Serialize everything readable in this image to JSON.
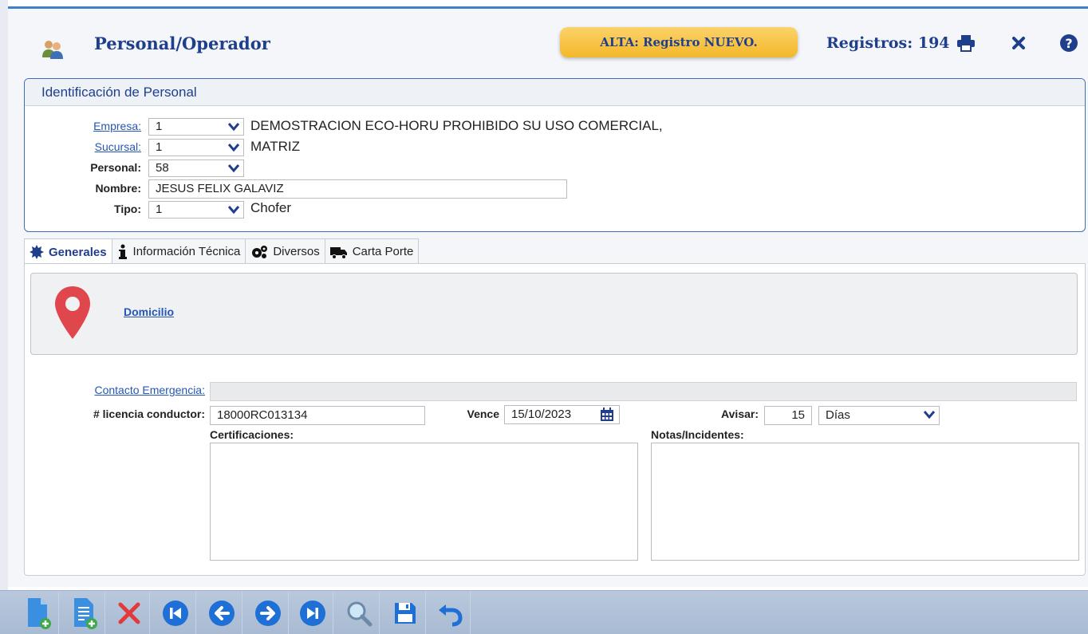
{
  "header": {
    "title": "Personal/Operador",
    "status_badge": "ALTA: Registro NUEVO.",
    "records_text": "Registros: 194"
  },
  "ident": {
    "title": "Identificación de Personal",
    "empresa": {
      "label": "Empresa:",
      "value": "1",
      "description": "DEMOSTRACION ECO-HORU PROHIBIDO SU USO COMERCIAL,"
    },
    "sucursal": {
      "label": "Sucursal:",
      "value": "1",
      "description": "MATRIZ"
    },
    "personal": {
      "label": "Personal:",
      "value": "58"
    },
    "nombre": {
      "label": "Nombre:",
      "value": "JESUS FELIX GALAVIZ"
    },
    "tipo": {
      "label": "Tipo:",
      "value": "1",
      "description": "Chofer"
    }
  },
  "tabs": [
    {
      "label": "Generales",
      "icon": "gear-badge-icon"
    },
    {
      "label": "Información Técnica",
      "icon": "info-icon"
    },
    {
      "label": "Diversos",
      "icon": "cogs-icon"
    },
    {
      "label": "Carta Porte",
      "icon": "truck-icon"
    }
  ],
  "generales": {
    "domicilio_link": "Domicilio",
    "contacto_label": "Contacto Emergencia:",
    "contacto_value": "",
    "licencia_label": "# licencia conductor:",
    "licencia_value": "18000RC013134",
    "vence_label": "Vence",
    "vence_value": "15/10/2023",
    "avisar_label": "Avisar:",
    "avisar_value": "15",
    "avisar_unit": "Días",
    "certificaciones_label": "Certificaciones:",
    "notas_label": "Notas/Incidentes:"
  },
  "toolbar": [
    "new-document-icon",
    "new-list-icon",
    "delete-icon",
    "first-record-icon",
    "previous-record-icon",
    "next-record-icon",
    "last-record-icon",
    "search-icon",
    "save-icon",
    "undo-icon"
  ],
  "colors": {
    "accent": "#1f3f8c",
    "link": "#2656b4",
    "badge": "#f4b829",
    "pin": "#e0474c"
  }
}
